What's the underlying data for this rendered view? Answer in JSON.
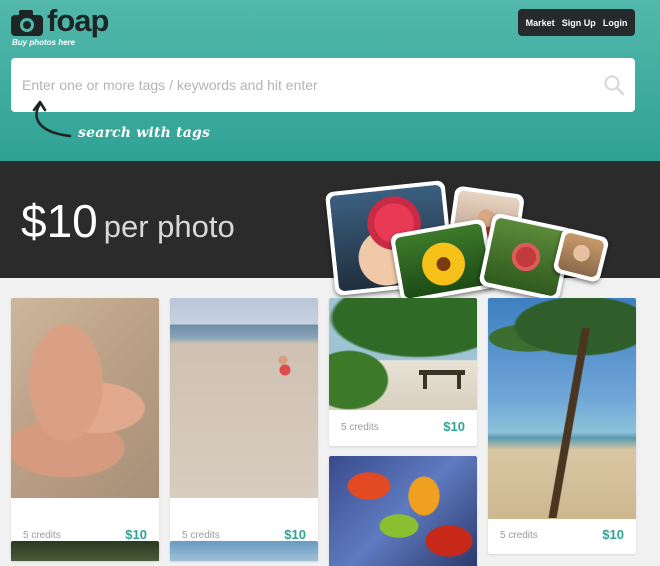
{
  "header": {
    "logo_text": "foap",
    "tagline": "Buy photos here",
    "nav": [
      "Market",
      "Sign Up",
      "Login"
    ],
    "search_placeholder": "Enter one or more tags / keywords and hit enter",
    "hint": "search with tags"
  },
  "banner": {
    "price": "$10",
    "unit": "per photo"
  },
  "photos": [
    {
      "credits": "5 credits",
      "price": "$10"
    },
    {
      "credits": "5 credits",
      "price": "$10"
    },
    {
      "credits": "5 credits",
      "price": "$10"
    },
    {
      "credits": "5 credits",
      "price": "$10"
    }
  ],
  "colors": {
    "accent": "#2fa294",
    "dark": "#2b2b2b",
    "nav": "#262a2a"
  }
}
